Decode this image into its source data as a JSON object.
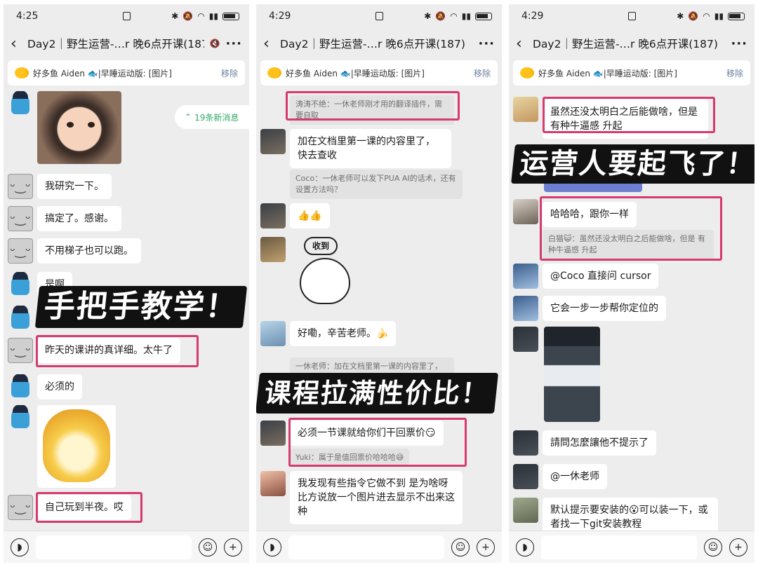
{
  "panels": [
    {
      "time": "4:25",
      "title": "Day2｜野生运营-…r 晚6点开课(187)",
      "pinned": "好多鱼 Aiden 🐟|早睡运动版: [图片]",
      "pinned_remove": "移除",
      "new_messages": "19条新消息",
      "messages": [
        "我研究一下。",
        "搞定了。感谢。",
        "不用梯子也可以跑。",
        "是啊",
        "昨天的课讲的真详细。太牛了",
        "必须的",
        "自己玩到半夜。哎"
      ],
      "overlay": "手把手教学！"
    },
    {
      "time": "4:29",
      "title": "Day2｜野生运营-…r 晚6点开课(187)",
      "pinned": "好多鱼 Aiden 🐟|早睡运动版: [图片]",
      "pinned_remove": "移除",
      "quote_top": "涛涛不绝：一休老师刚才用的翻译插件，需要自取",
      "msg_doc": "加在文档里第一课的内容里了，快去查收",
      "quote_coco": "Coco：一休老师可以发下PUA AI的话术，还有设置方法吗？",
      "msg_thumbs": "👍👍",
      "sticker_text": "收到",
      "msg_thanks": "好嘞，辛苦老师。🍌",
      "quote_yixiu": "一休老师：加在文档里第一课的内容里了，快去查收",
      "overlay": "课程拉满性价比！",
      "msg_ticket": "必须一节课就给你们干回票价😏",
      "quote_yuki": "Yuki：属于是值回票价哈哈哈😅",
      "msg_long": "我发现有些指令它做不到 是为啥呀 比方说放一个图片进去显示不出来这种"
    },
    {
      "time": "4:29",
      "title": "Day2｜野生运营-…r 晚6点开课(187)",
      "pinned": "好多鱼 Aiden 🐟|早睡运动版: [图片]",
      "pinned_remove": "移除",
      "msg_1": "虽然还没太明白之后能做啥，但是 有种牛逼感 升起",
      "overlay": "运营人要起飞了！",
      "msg_2": "哈哈哈，跟你一样",
      "quote_baimao": "白猫😺：虽然还没太明白之后能做啥，但是 有种牛逼感 升起",
      "msg_3": "@Coco 直接问 cursor",
      "msg_4": "它会一步一步帮你定位的",
      "msg_5": "請問怎麼讓他不提示了",
      "msg_6": "@一休老师",
      "msg_7": "默认提示要安装的😮可以装一下，或者找一下git安装教程"
    }
  ],
  "colors": {
    "highlight": "#d63a6e",
    "background": "#ededed",
    "bubble": "#ffffff",
    "new_msg": "#33aa66"
  }
}
